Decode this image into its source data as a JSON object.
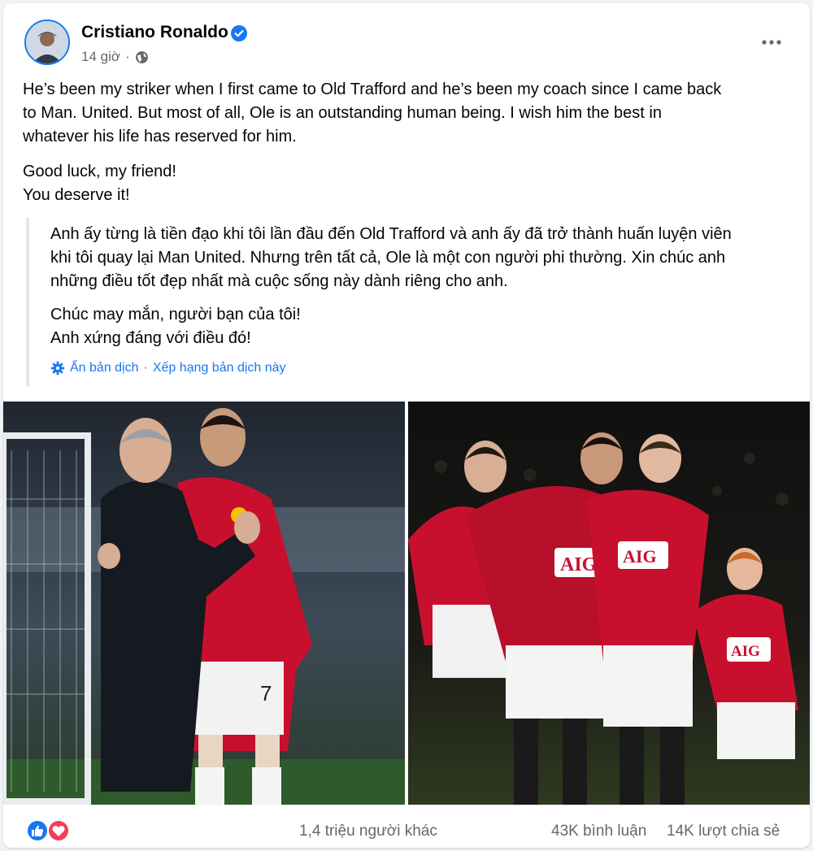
{
  "post": {
    "author": "Cristiano Ronaldo",
    "verified": true,
    "time": "14 giờ",
    "privacy_icon": "globe-icon",
    "more_icon": "more-horizontal-icon",
    "text_paragraph_1": "He’s been my striker when I first came to Old Trafford and he’s been my coach since I came back\nto Man. United. But most of all, Ole is an outstanding human being. I wish him the best in\nwhatever his life has reserved for him.",
    "text_paragraph_2": "Good luck, my friend!\nYou deserve it!"
  },
  "translation": {
    "paragraph_1": "Anh ấy từng là tiền đạo khi tôi lần đầu đến Old Trafford và anh ấy đã trở thành huấn luyện viên\nkhi tôi quay lại Man United. Nhưng trên tất cả, Ole là một con người phi thường. Xin chúc anh\nnhững điều tốt đẹp nhất mà cuộc sống này dành riêng cho anh.",
    "paragraph_2": "Chúc may mắn, người bạn của tôi!\nAnh xứng đáng với điều đó!",
    "hide_label": "Ẩn bản dịch",
    "separator": "·",
    "rate_label": "Xếp hạng bản dịch này"
  },
  "stats": {
    "reactions_text": "1,4 triệu người khác",
    "comments_text": "43K bình luận",
    "shares_text": "14K lượt chia sẻ"
  },
  "colors": {
    "accent": "#1877f2",
    "secondary_text": "#65676b",
    "love": "#f33e58",
    "man_united_red": "#c8102e"
  }
}
